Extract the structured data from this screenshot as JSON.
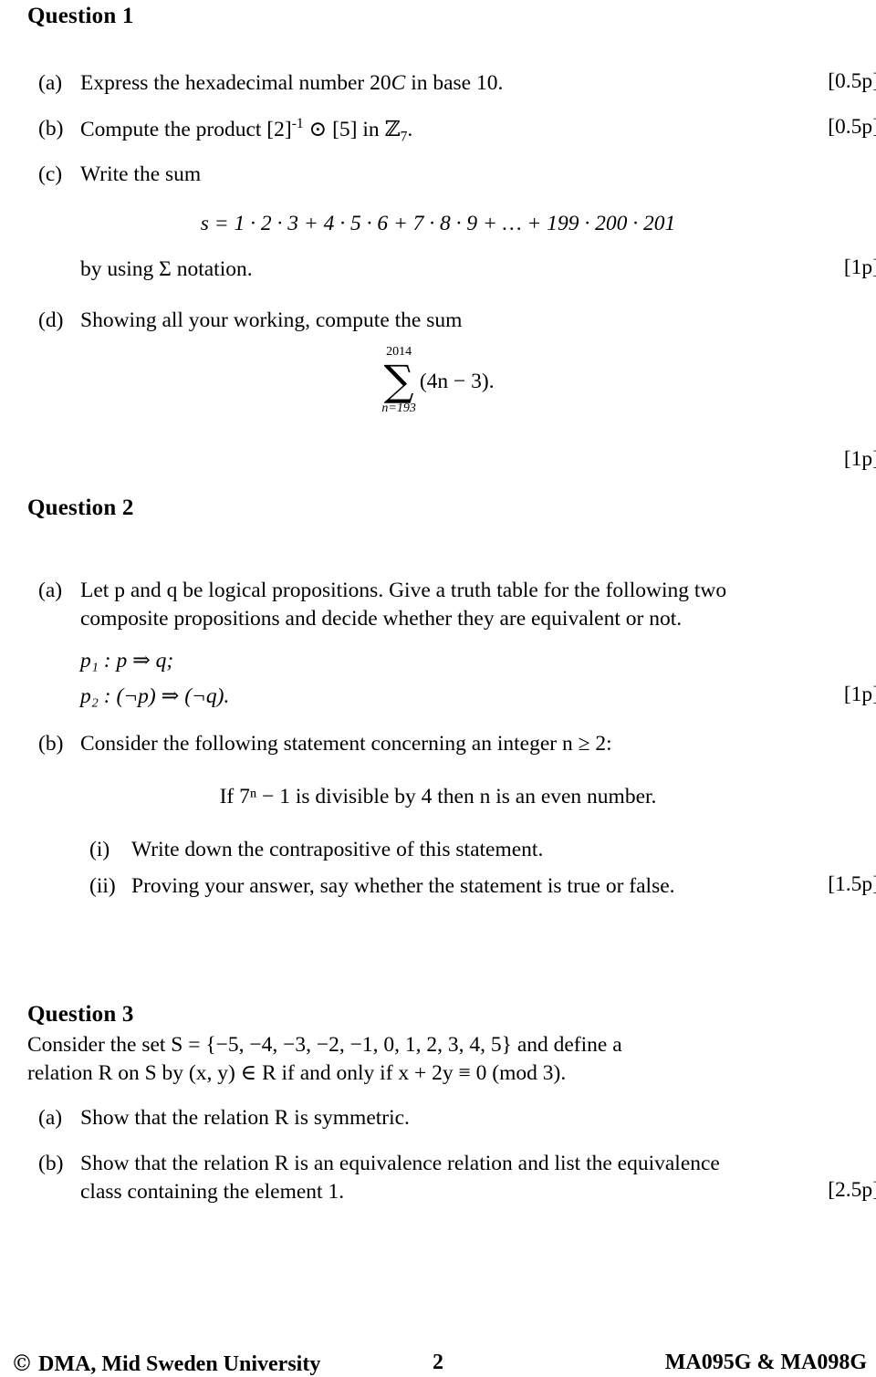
{
  "document": {
    "type": "exam-paper",
    "page_number": "2",
    "course_codes": "MA095G & MA098G",
    "copyright": "DMA, Mid Sweden University",
    "copyright_symbol": "©"
  },
  "questions": [
    {
      "heading": "Question 1",
      "items": [
        {
          "label": "(a)",
          "text_before": "Express the hexadecimal number 20",
          "math_var": "C",
          "text_after": " in base 10.",
          "marks": "[0.5p]"
        },
        {
          "label": "(b)",
          "text_before": "Compute the product [2]",
          "exponent": "-1",
          "operator": "⊙",
          "bracket": "[5]",
          "text_mid": " in ",
          "set_symbol": "ℤ",
          "set_subscript": "7",
          "text_after": ".",
          "marks": "[0.5p]"
        },
        {
          "label": "(c)",
          "text": "Write the sum",
          "display_equation": "s = 1 · 2 · 3 + 4 · 5 · 6 + 7 · 8 · 9 + … + 199 · 200 · 201",
          "continuation": "by using Σ notation.",
          "marks": "[1p]"
        },
        {
          "label": "(d)",
          "text": "Showing all your working, compute the sum",
          "summation": {
            "upper_limit": "2014",
            "sigma": "∑",
            "lower_limit": "n=193",
            "summand": "(4n − 3)."
          },
          "marks": "[1p]"
        }
      ]
    },
    {
      "heading": "Question 2",
      "items": [
        {
          "label": "(a)",
          "line1": "Let p and q be logical propositions.  Give a truth table for the following two",
          "line2": "composite propositions and decide whether they are equivalent or not.",
          "prop1": "p₁ : p ⇒ q;",
          "prop2": "p₂ : (¬p) ⇒ (¬q).",
          "marks": "[1p]"
        },
        {
          "label": "(b)",
          "text": "Consider the following statement concerning an integer n ≥ 2:",
          "statement": "If 7ⁿ − 1 is divisible by 4 then n is an even number.",
          "subitems": [
            {
              "label": "(i)",
              "text": "Write down the contrapositive of this statement.",
              "marks": ""
            },
            {
              "label": "(ii)",
              "text": "Proving your answer, say whether the statement is true or false.",
              "marks": "[1.5p]"
            }
          ]
        }
      ]
    },
    {
      "heading": "Question 3",
      "preamble_line1": "Consider the set S = {−5, −4, −3, −2, −1, 0, 1, 2, 3, 4, 5} and define a",
      "preamble_line2": "relation R on S by (x, y) ∈ R if and only if x + 2y ≡ 0 (mod 3).",
      "items": [
        {
          "label": "(a)",
          "text": "Show that the relation R is symmetric.",
          "marks": ""
        },
        {
          "label": "(b)",
          "line1": "Show that the relation R is an equivalence relation and list the equivalence",
          "line2": "class containing the element 1.",
          "marks": "[2.5p]"
        }
      ]
    }
  ]
}
